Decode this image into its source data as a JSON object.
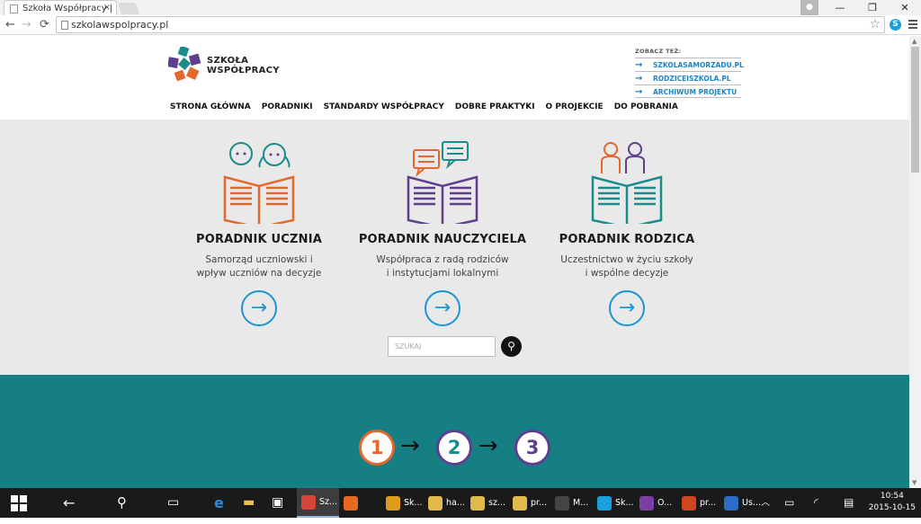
{
  "browser": {
    "tab_title": "Szkoła Współpracy |",
    "tab_close": "×",
    "url": "szkolawspolpracy.pl",
    "back": "←",
    "forward": "→",
    "reload": "C",
    "minimize": "—",
    "maximize": "❐",
    "close": "✕",
    "skype_ext": "S"
  },
  "site": {
    "logo_line1": "SZKOŁA",
    "logo_line2": "WSPÓŁPRACY",
    "nav": [
      "STRONA GŁÓWNA",
      "PORADNIKI",
      "STANDARDY WSPÓŁPRACY",
      "DOBRE PRAKTYKI",
      "O PROJEKCIE",
      "DO POBRANIA"
    ],
    "see_also_label": "ZOBACZ TEŻ:",
    "see_also": [
      "SZKOLASAMORZADU.PL",
      "RODZICEISZKOLA.PL",
      "ARCHIWUM PROJEKTU"
    ],
    "guides": [
      {
        "title": "PORADNIK UCZNIA",
        "subtitle": "Samorząd uczniowski i\nwpływ uczniów na decyzje",
        "color": "#e4672c"
      },
      {
        "title": "PORADNIK NAUCZYCIELA",
        "subtitle": "Współpraca z radą rodziców\ni instytucjami lokalnymi",
        "color": "#5e3f8f"
      },
      {
        "title": "PORADNIK RODZICA",
        "subtitle": "Uczestnictwo w życiu szkoły\ni wspólne decyzje",
        "color": "#1a8c8c"
      }
    ],
    "search_placeholder": "SZUKAJ",
    "steps": [
      {
        "num": "1",
        "color": "#e4672c"
      },
      {
        "num": "2",
        "color": "#1a8c8c"
      },
      {
        "num": "3",
        "color": "#5e3f8f"
      }
    ]
  },
  "taskbar": {
    "apps": [
      {
        "label": "Sz...",
        "icon": "chrome-icon",
        "color": "#d9443a",
        "active": true
      },
      {
        "label": "",
        "icon": "firefox-icon",
        "color": "#e8681d",
        "active": false
      },
      {
        "label": "Sk...",
        "icon": "outlook-icon",
        "color": "#e09a1c",
        "active": false
      },
      {
        "label": "ha...",
        "icon": "mail-icon",
        "color": "#e0b94a",
        "active": false
      },
      {
        "label": "sz...",
        "icon": "mail-icon",
        "color": "#e0b94a",
        "active": false
      },
      {
        "label": "pr...",
        "icon": "mail-icon",
        "color": "#e0b94a",
        "active": false
      },
      {
        "label": "M...",
        "icon": "media-icon",
        "color": "#444444",
        "active": false
      },
      {
        "label": "Sk...",
        "icon": "skype-icon",
        "color": "#1aa0e0",
        "active": false
      },
      {
        "label": "O...",
        "icon": "onenote-icon",
        "color": "#7b3ea3",
        "active": false
      },
      {
        "label": "pr...",
        "icon": "powerpoint-icon",
        "color": "#d0461f",
        "active": false
      },
      {
        "label": "Us...",
        "icon": "settings-icon",
        "color": "#2b6cc4",
        "active": false
      }
    ],
    "time": "10:54",
    "date": "2015-10-15"
  }
}
